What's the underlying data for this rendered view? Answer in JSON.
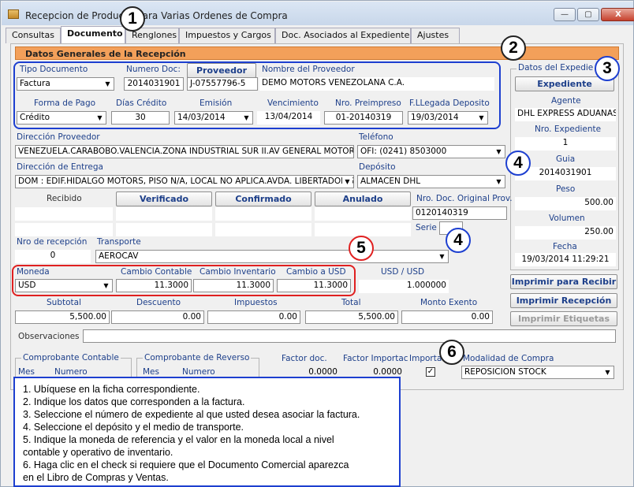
{
  "window": {
    "title": "Recepcion de Producto para Varias Ordenes de Compra",
    "minimize": "—",
    "maximize": "▢",
    "close": "X"
  },
  "tabs": [
    {
      "label": "Consultas"
    },
    {
      "label": "Documento"
    },
    {
      "label": "Renglones"
    },
    {
      "label": "Impuestos y Cargos"
    },
    {
      "label": "Doc. Asociados al Expediente"
    },
    {
      "label": "Ajustes"
    }
  ],
  "section_title": "Datos Generales de la Recepción",
  "general": {
    "tipo_documento_label": "Tipo Documento",
    "tipo_documento": "Factura",
    "numero_doc_label": "Numero Doc:",
    "numero_doc": "2014031901",
    "proveedor_button": "Proveedor",
    "proveedor_code": "J-07557796-5",
    "nombre_proveedor_label": "Nombre del Proveedor",
    "nombre_proveedor": "DEMO MOTORS VENEZOLANA C.A.",
    "forma_pago_label": "Forma de Pago",
    "forma_pago": "Crédito",
    "dias_credito_label": "Días Crédito",
    "dias_credito": "30",
    "emision_label": "Emisión",
    "emision": "14/03/2014",
    "vencimiento_label": "Vencimiento",
    "vencimiento": "13/04/2014",
    "nro_preimpreso_label": "Nro. Preimpreso",
    "nro_preimpreso": "01-20140319",
    "fllegada_label": "F.LLegada Deposito",
    "fllegada": "19/03/2014"
  },
  "expediente": {
    "group_label": "Datos del Expedie",
    "button": "Expediente",
    "agente_label": "Agente",
    "agente": "DHL EXPRESS ADUANAS",
    "nro_label": "Nro. Expediente",
    "nro": "1",
    "guia_label": "Guia",
    "guia": "2014031901",
    "peso_label": "Peso",
    "peso": "500.00",
    "volumen_label": "Volumen",
    "volumen": "250.00",
    "fecha_label": "Fecha",
    "fecha": "19/03/2014 11:29:21"
  },
  "direccion": {
    "proveedor_label": "Dirección Proveedor",
    "proveedor": "VENEZUELA.CARABOBO.VALENCIA.ZONA INDUSTRIAL SUR II.AV GENERAL MOTORS",
    "telefono_label": "Teléfono",
    "telefono": "OFI: (0241) 8503000",
    "entrega_label": "Dirección de Entrega",
    "entrega": "DOM : EDIF.HIDALGO MOTORS, PISO N/A, LOCAL NO APLICA.AVDA. LIBERTADOR.S",
    "deposito_label": "Depósito",
    "deposito": "ALMACEN DHL"
  },
  "status": {
    "recibido_label": "Recibido",
    "verificado_button": "Verificado",
    "confirmado_button": "Confirmado",
    "anulado_button": "Anulado",
    "nro_doc_original_label": "Nro. Doc. Original Prov.",
    "nro_doc_original": "0120140319",
    "serie_label": "Serie"
  },
  "recepcion": {
    "nro_label": "Nro de recepción",
    "nro": "0",
    "transporte_label": "Transporte",
    "transporte": "AEROCAV"
  },
  "moneda": {
    "moneda_label": "Moneda",
    "moneda": "USD",
    "cambio_contable_label": "Cambio Contable",
    "cambio_contable": "11.3000",
    "cambio_inventario_label": "Cambio Inventario",
    "cambio_inventario": "11.3000",
    "cambio_usd_label": "Cambio a USD",
    "cambio_usd": "11.3000",
    "usd_usd_label": "USD / USD",
    "usd_usd": "1.000000"
  },
  "totales": {
    "subtotal_label": "Subtotal",
    "subtotal": "5,500.00",
    "descuento_label": "Descuento",
    "descuento": "0.00",
    "impuestos_label": "Impuestos",
    "impuestos": "0.00",
    "total_label": "Total",
    "total": "5,500.00",
    "monto_exento_label": "Monto Exento",
    "monto_exento": "0.00"
  },
  "observaciones_label": "Observaciones",
  "actions": {
    "imprimir_recibir": "Imprimir para Recibir",
    "imprimir_recepcion": "Imprimir Recepción",
    "imprimir_etiquetas": "Imprimir Etiquetas"
  },
  "bottom": {
    "comprobante_contable": "Comprobante Contable",
    "comprobante_reverso": "Comprobante de Reverso",
    "mes": "Mes",
    "numero": "Numero",
    "factor_doc_label": "Factor doc.",
    "factor_doc": "0.0000",
    "factor_importac_label": "Factor Importac",
    "factor_importac": "0.0000",
    "importac_label": "Importac",
    "modalidad_label": "Modalidad de Compra",
    "modalidad": "REPOSICION STOCK"
  },
  "callouts": [
    "1",
    "2",
    "3",
    "4",
    "5",
    "4",
    "6"
  ],
  "instructions": [
    "1. Ubíquese en la ficha correspondiente.",
    "2. Indique los datos que corresponden a la factura.",
    "3. Seleccione el número de expediente al que usted desea asociar la factura.",
    "4. Seleccione el depósito y el medio de transporte.",
    "5. Indique la moneda de referencia y el valor en la moneda local a nivel",
    "contable y operativo de inventario.",
    "6. Haga clic en el check si requiere que el Documento Comercial aparezca",
    "en el Libro de Compras y Ventas."
  ],
  "colors": {
    "header": "#f3a05a",
    "label": "#1d3f8a",
    "callout_blue": "#1d3fd0",
    "callout_red": "#e02020"
  }
}
